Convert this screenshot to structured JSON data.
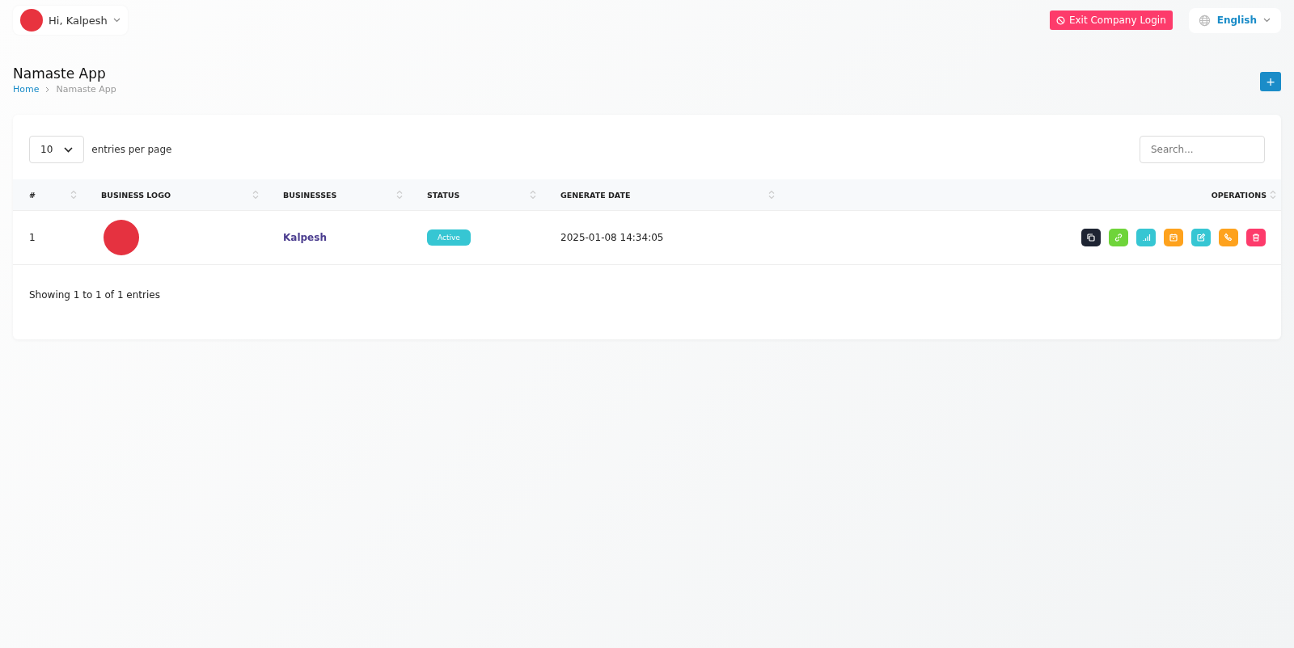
{
  "user_menu": {
    "greeting": "Hi, Kalpesh"
  },
  "exit_button": {
    "label": "Exit Company Login"
  },
  "language": {
    "label": "English"
  },
  "page": {
    "title": "Namaste App",
    "breadcrumb": [
      {
        "label": "Home",
        "kind": "link"
      },
      {
        "label": "Namaste App",
        "kind": "current"
      }
    ]
  },
  "add_button": {
    "label": "+"
  },
  "entries": {
    "value": "10",
    "label": "entries per page"
  },
  "search": {
    "placeholder": "Search..."
  },
  "table": {
    "columns": [
      "#",
      "BUSINESS LOGO",
      "BUSINESSES",
      "STATUS",
      "GENERATE DATE",
      "OPERATIONS"
    ],
    "rows": [
      {
        "number": "1",
        "business": "Kalpesh",
        "status": "Active",
        "date": "2025-01-08 14:34:05",
        "operations": [
          {
            "kind": "copy",
            "color": "#1e2433"
          },
          {
            "kind": "link",
            "color": "#6fd43a"
          },
          {
            "kind": "chart",
            "color": "#36c6d3"
          },
          {
            "kind": "calendar",
            "color": "#fea21d"
          },
          {
            "kind": "edit",
            "color": "#36c6d3"
          },
          {
            "kind": "phone",
            "color": "#fea21d"
          },
          {
            "kind": "delete",
            "color": "#fd3b6b"
          }
        ]
      }
    ]
  },
  "footer": {
    "info": "Showing 1 to 1 of 1 entries"
  }
}
